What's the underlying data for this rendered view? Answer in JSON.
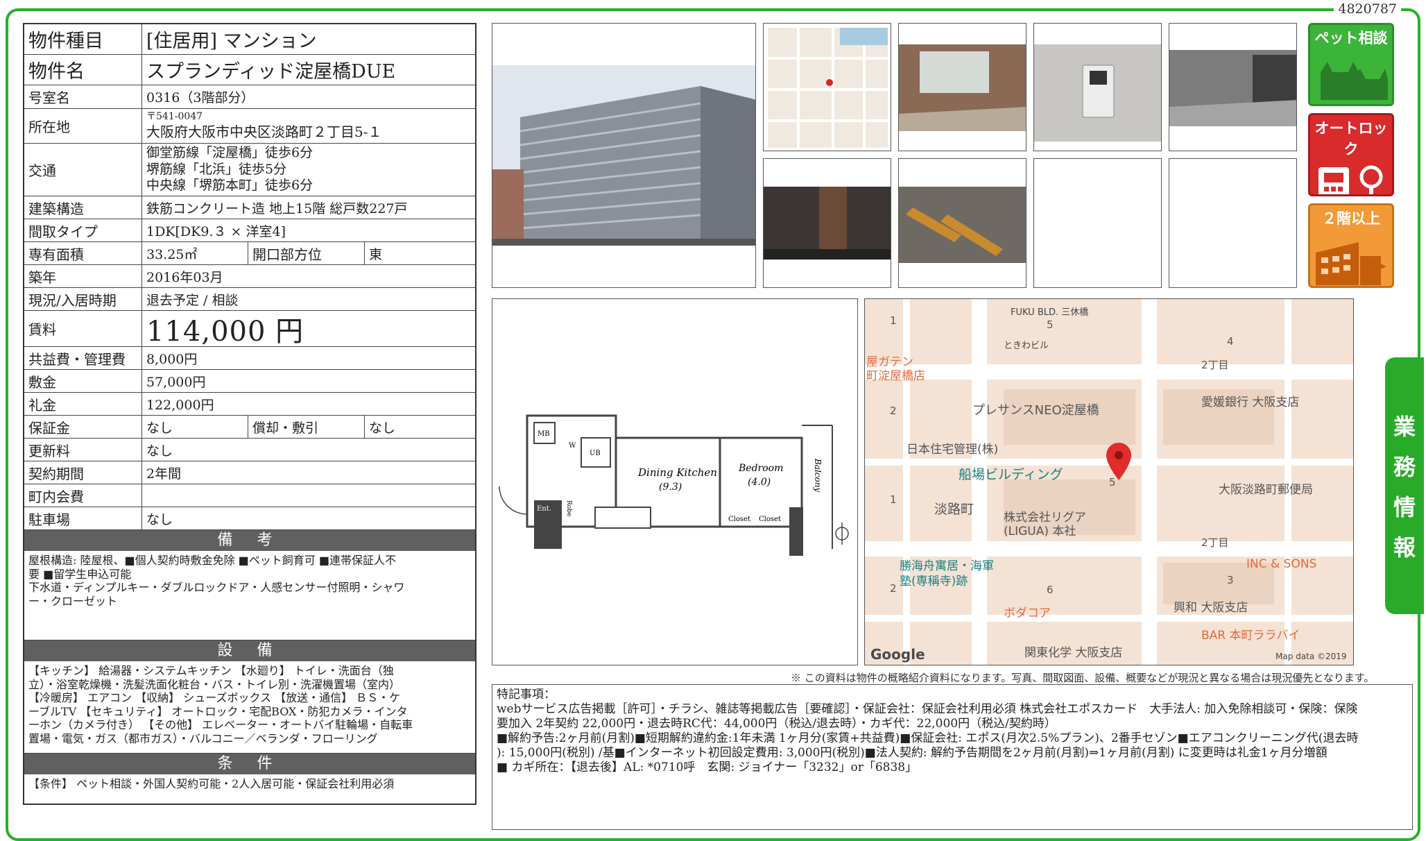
{
  "doc_id": "4820787",
  "fields": {
    "type_label": "物件種目",
    "type_value": "[住居用] マンション",
    "name_label": "物件名",
    "name_value": "スプランディッド淀屋橋DUE",
    "room_label": "号室名",
    "room_value": "0316（3階部分）",
    "address_label": "所在地",
    "postal": "〒541-0047",
    "address": "大阪府大阪市中央区淡路町２丁目5-１",
    "transit_label": "交通",
    "transit": [
      "御堂筋線「淀屋橋」徒歩6分",
      "堺筋線「北浜」徒歩5分",
      "中央線「堺筋本町」徒歩6分"
    ],
    "structure_label": "建築構造",
    "structure_value": "鉄筋コンクリート造 地上15階 総戸数227戸",
    "layout_label": "間取タイプ",
    "layout_value": "1DK[DK9.３ × 洋室4]",
    "area_label": "専有面積",
    "area_value": "33.25㎡",
    "opening_label": "開口部方位",
    "opening_value": "東",
    "built_label": "築年",
    "built_value": "2016年03月",
    "status_label": "現況/入居時期",
    "status_value": "退去予定 / 相談",
    "rent_label": "賃料",
    "rent_value": "114,000 円",
    "fee_label": "共益費・管理費",
    "fee_value": "8,000円",
    "deposit_label": "敷金",
    "deposit_value": "57,000円",
    "keymoney_label": "礼金",
    "keymoney_value": "122,000円",
    "guarantee_label": "保証金",
    "guarantee_value": "なし",
    "amort_label": "償却・敷引",
    "amort_value": "なし",
    "renewal_label": "更新料",
    "renewal_value": "なし",
    "contract_label": "契約期間",
    "contract_value": "2年間",
    "town_label": "町内会費",
    "town_value": "",
    "parking_label": "駐車場",
    "parking_value": "なし"
  },
  "sections": {
    "remarks_title": "備 考",
    "remarks_lines": [
      "屋根構造: 陸屋根、■個人契約時敷金免除 ■ペット飼育可 ■連帯保証人不",
      "要 ■留学生申込可能",
      "下水道・ディンプルキー・ダブルロックドア・人感センサー付照明・シャワ",
      "ー・クローゼット"
    ],
    "equip_title": "設 備",
    "equip_lines": [
      "【キッチン】 給湯器・システムキッチン 【水廻り】 トイレ・洗面台（独",
      "立）・浴室乾燥機・洗髪洗面化粧台・バス・トイレ別・洗濯機置場（室内）",
      "【冷暖房】 エアコン 【収納】 シューズボックス 【放送・通信】 ＢＳ・ケ",
      "ーブルTV 【セキュリティ】 オートロック・宅配BOX・防犯カメラ・インタ",
      "ーホン（カメラ付き） 【その他】 エレベーター・オートバイ駐輪場・自転車",
      "置場・電気・ガス（都市ガス）・バルコニー／ベランダ・フローリング"
    ],
    "cond_title": "条 件",
    "cond_text": "【条件】 ペット相談・外国人契約可能・2人入居可能・保証会社利用必須"
  },
  "badges": {
    "pet": "ペット相談",
    "autolock": "オートロック",
    "floor2": "２階以上"
  },
  "side_tab": [
    "業",
    "務",
    "情",
    "報"
  ],
  "floorplan": {
    "dining": "Dining Kitchen",
    "dining_size": "(9.3)",
    "bedroom": "Bedroom",
    "bedroom_size": "(4.0)",
    "balcony": "Balcony",
    "closet1": "Closet",
    "closet2": "Closet",
    "mb": "MB",
    "ub": "UB",
    "w": "W",
    "ent": "Ent.",
    "shoe": "Robe"
  },
  "map": {
    "labels": [
      "FUKU BLD. 三休橋",
      "ときわビル",
      "屋ガテン",
      "町淀屋橋店",
      "プレサンスNEO淀屋橋",
      "愛媛銀行 大阪支店",
      "日本住宅管理(株)",
      "船場ビルディング",
      "淡路町",
      "株式会社リグア",
      "(LIGUA) 本社",
      "大阪淡路町郵便局",
      "勝海舟寓居・海軍",
      "塾(専稱寺)跡",
      "INC & SONS",
      "興和 大阪支店",
      "ボダコア",
      "BAR 本町ララバイ",
      "関東化学 大阪支店",
      "2丁目",
      "2丁目",
      "Google",
      "Map data ©2019"
    ],
    "block_numbers": [
      "1",
      "5",
      "4",
      "2",
      "1",
      "5",
      "2",
      "6",
      "3"
    ]
  },
  "caution": "※ この資料は物件の概略紹介資料になります。写真、間取図面、設備、概要などが現況と異なる場合は現況優先となります。",
  "remarks_box": {
    "lines": [
      "特記事項：",
      "webサービス広告掲載［許可］・チラシ、雑誌等掲載広告［要確認］・保証会社：保証会社利用必須 株式会社エポスカード　大手法人: 加入免除相談可・保険：保険",
      "要加入 2年契約 22,000円・退去時RC代：44,000円（税込/退去時）・カギ代：22,000円（税込/契約時）",
      "■解約予告:2ヶ月前(月割)■短期解約違約金:1年未満 1ヶ月分(家賃+共益費)■保証会社: エポス(月次2.5%プラン)、2番手セゾン■エアコンクリーニング代(退去時",
      "): 15,000円(税別) /基■インターネット初回設定費用: 3,000円(税別)■法人契約: 解約予告期間を2ヶ月前(月割)⇒1ヶ月前(月割) に変更時は礼金1ヶ月分増額",
      "■ カギ所在：【退去後】AL: *0710呼　玄関: ジョイナー「3232」or「6838」"
    ]
  }
}
